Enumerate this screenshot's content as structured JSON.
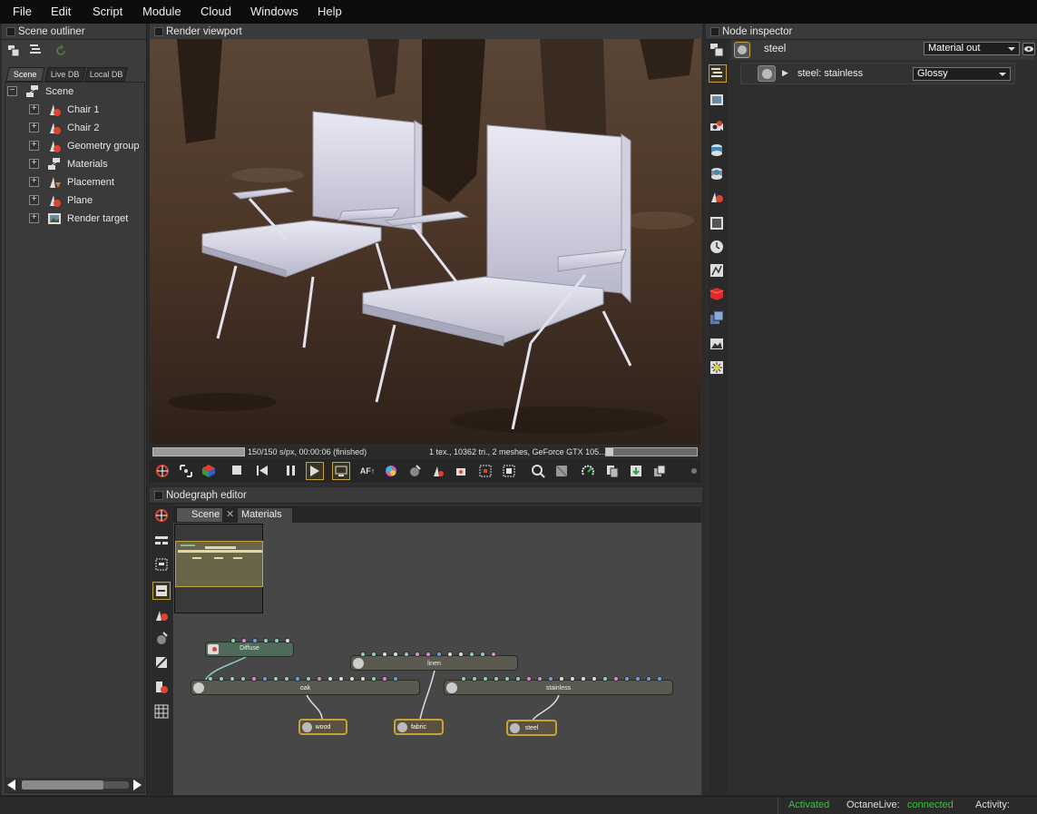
{
  "menu": [
    "File",
    "Edit",
    "Script",
    "Module",
    "Cloud",
    "Windows",
    "Help"
  ],
  "outliner": {
    "title": "Scene outliner",
    "tabs": [
      "Scene",
      "Live DB",
      "Local DB"
    ],
    "root": "Scene",
    "items": [
      "Chair 1",
      "Chair 2",
      "Geometry group",
      "Materials",
      "Placement",
      "Plane",
      "Render target"
    ]
  },
  "viewport": {
    "title": "Render viewport",
    "progress": 1.0,
    "samples": "150/150 s/px, 00:00:06 (finished)",
    "stats": "1 tex., 10362 tri., 2 meshes, GeForce GTX 105..."
  },
  "nodegraph": {
    "title": "Nodegraph editor",
    "tabs": [
      "Scene",
      "Materials"
    ],
    "nodes": {
      "diffuse": "Diffuse",
      "linen": "linen",
      "oak": "oak",
      "stainless": "stainless",
      "wood": "wood",
      "fabric": "fabric",
      "steel": "steel"
    }
  },
  "inspector": {
    "title": "Node inspector",
    "node_name": "steel",
    "node_type": "Material out",
    "child_name": "steel: stainless",
    "child_type": "Glossy"
  },
  "statusbar": {
    "activation": "Activated",
    "live_label": "OctaneLive:",
    "live_status": "connected",
    "activity_label": "Activity:"
  },
  "colors": {
    "accent_gold": "#c6a33a",
    "status_green": "#35c63a",
    "menubar": "#0d0d0d"
  }
}
